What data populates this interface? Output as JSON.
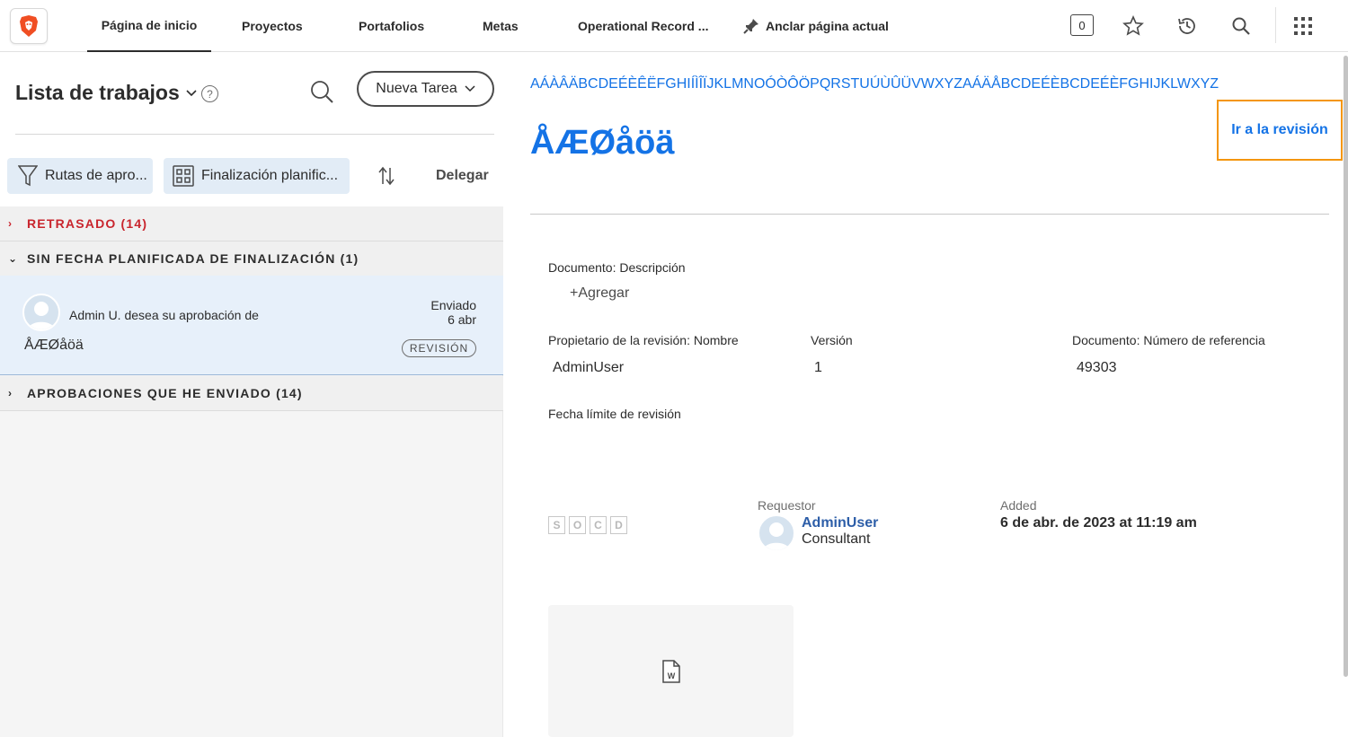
{
  "nav": {
    "tabs": [
      {
        "label": "Página de inicio"
      },
      {
        "label": "Proyectos"
      },
      {
        "label": "Portafolios"
      },
      {
        "label": "Metas"
      },
      {
        "label": "Operational Record ..."
      }
    ],
    "pin_label": "Anclar página actual",
    "counter": "0",
    "icons": [
      "star-icon",
      "history-icon",
      "search-icon",
      "apps-grid-icon"
    ]
  },
  "worklist": {
    "title": "Lista de trabajos",
    "help": "?",
    "new_task_label": "Nueva Tarea",
    "filters": [
      {
        "label": "Rutas de apro..."
      },
      {
        "label": "Finalización planific..."
      }
    ],
    "delegate_label": "Delegar",
    "groups": [
      {
        "label": "RETRASADO (14)",
        "chev": "›",
        "color": "#c9252d"
      },
      {
        "label": "SIN FECHA PLANIFICADA DE FINALIZACIÓN (1)",
        "chev": "⌄",
        "color": "#2c2c2c"
      },
      {
        "label": "APROBACIONES QUE HE ENVIADO (14)",
        "chev": "›",
        "color": "#2c2c2c"
      }
    ],
    "item": {
      "requester_text": "Admin U. desea su aprobación de",
      "doc_name": "ÅÆØåöä",
      "status_line1": "Enviado",
      "status_line2": "6 abr",
      "badge": "REVISIÓN"
    }
  },
  "detail": {
    "alphabet_link": "AÁÀÂÄBCDEÉÈÊËFGHIÍÌÎÏJKLMNOÓÒÔÖPQRSTUÚÙÛÜVWXYZAÁÄÅBCDEÉÈBCDEÉÈFGHIJKLWXYZ",
    "title": "ÅÆØåöä",
    "goto_review": "Ir a la revisión",
    "desc_label": "Documento: Descripción",
    "add_label": "+Agregar",
    "owner_label": "Propietario de la revisión: Nombre",
    "owner_value": "AdminUser",
    "version_label": "Versión",
    "version_value": "1",
    "ref_label": "Documento: Número de referencia",
    "ref_value": "49303",
    "deadline_label": "Fecha límite de revisión",
    "socd": [
      "S",
      "O",
      "C",
      "D"
    ],
    "requestor_label": "Requestor",
    "requestor_name": "AdminUser",
    "requestor_role": "Consultant",
    "added_label": "Added",
    "added_value": "6 de abr. de 2023 at 11:19 am"
  },
  "colors": {
    "accent": "#1473e6",
    "highlight_border": "#f4960d",
    "late_red": "#c9252d"
  }
}
